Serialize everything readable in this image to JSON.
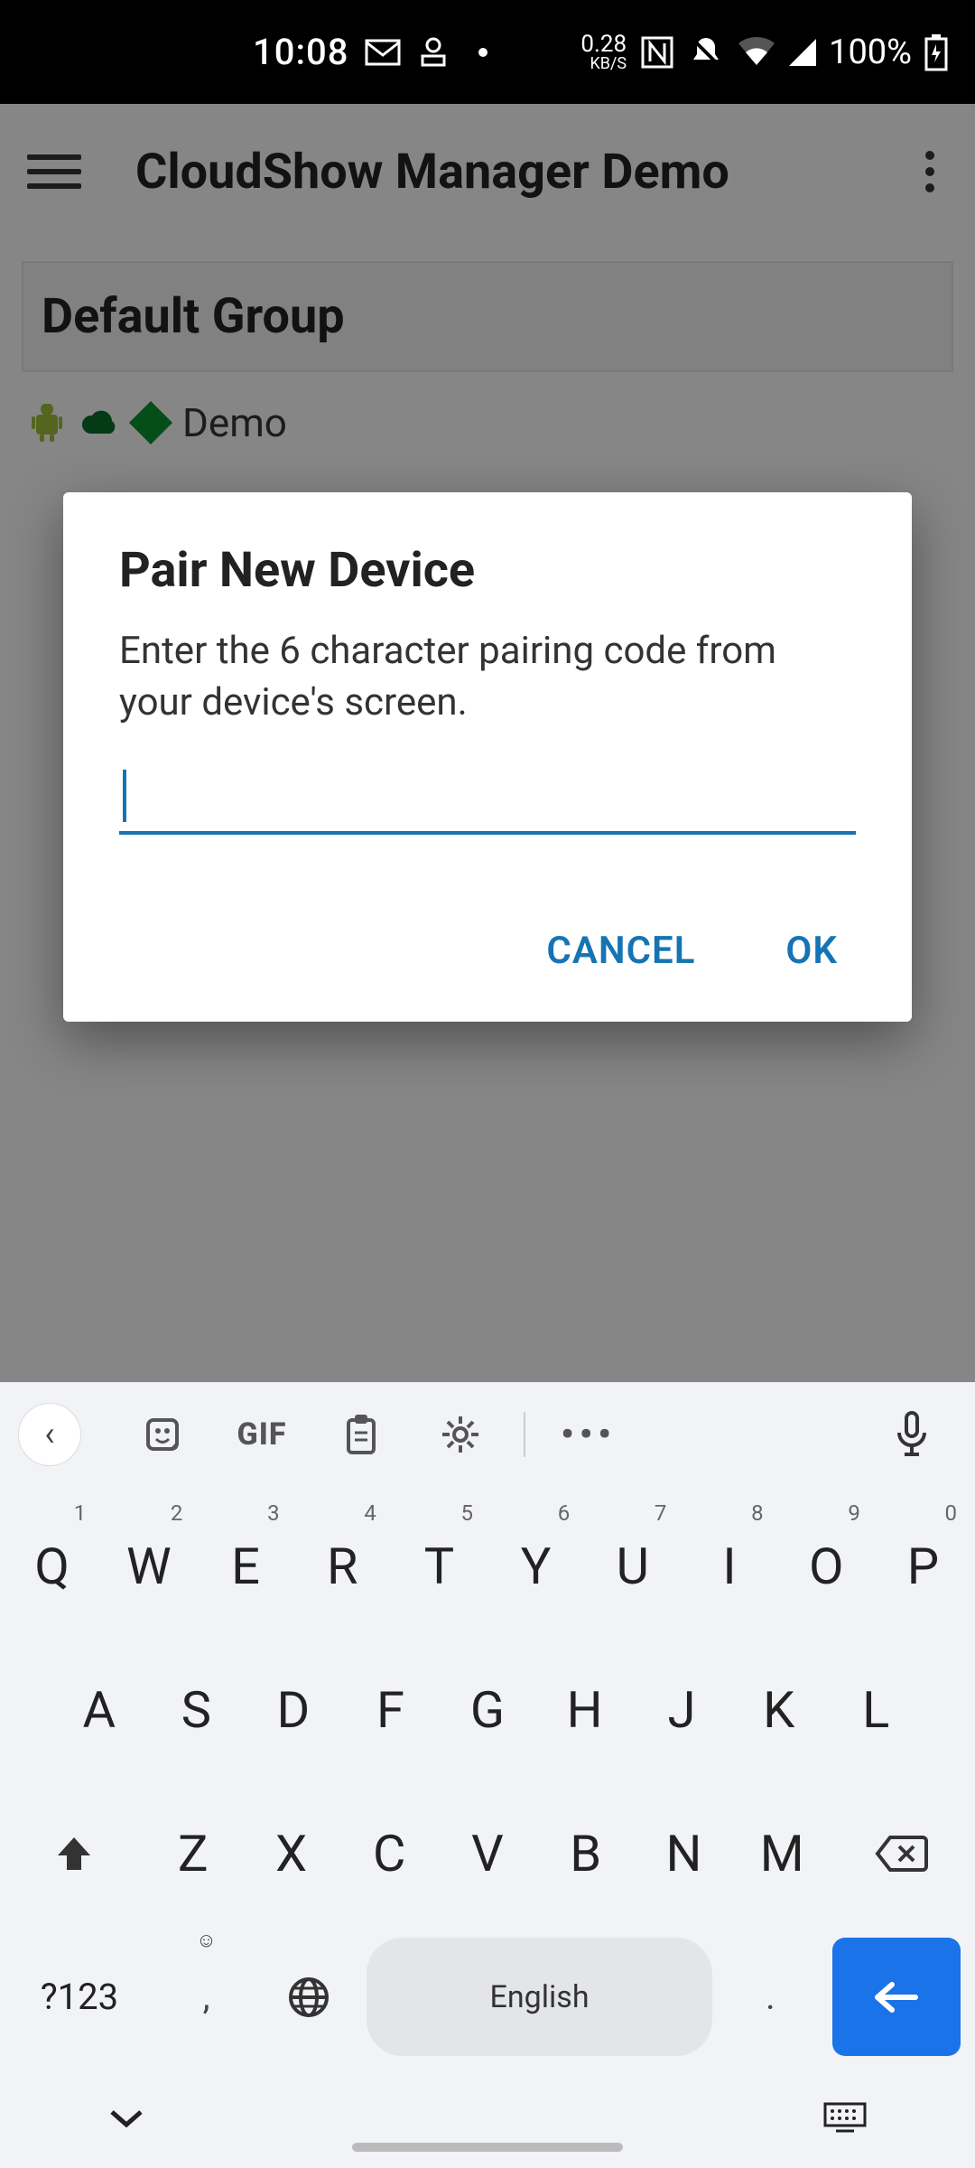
{
  "status": {
    "time": "10:08",
    "net_speed": "0.28",
    "net_unit": "KB/S",
    "battery": "100%"
  },
  "appbar": {
    "title": "CloudShow Manager Demo"
  },
  "group": {
    "title": "Default Group",
    "device_name": "Demo"
  },
  "dialog": {
    "title": "Pair New Device",
    "body": "Enter the 6 character pairing code from your device's screen.",
    "input_value": "",
    "cancel": "CANCEL",
    "ok": "OK"
  },
  "keyboard": {
    "gif": "GIF",
    "more": "•••",
    "row1": [
      {
        "k": "Q",
        "s": "1"
      },
      {
        "k": "W",
        "s": "2"
      },
      {
        "k": "E",
        "s": "3"
      },
      {
        "k": "R",
        "s": "4"
      },
      {
        "k": "T",
        "s": "5"
      },
      {
        "k": "Y",
        "s": "6"
      },
      {
        "k": "U",
        "s": "7"
      },
      {
        "k": "I",
        "s": "8"
      },
      {
        "k": "O",
        "s": "9"
      },
      {
        "k": "P",
        "s": "0"
      }
    ],
    "row2": [
      "A",
      "S",
      "D",
      "F",
      "G",
      "H",
      "J",
      "K",
      "L"
    ],
    "row3": [
      "Z",
      "X",
      "C",
      "V",
      "B",
      "N",
      "M"
    ],
    "sym": "?123",
    "comma": ",",
    "space": "English",
    "period": "."
  }
}
